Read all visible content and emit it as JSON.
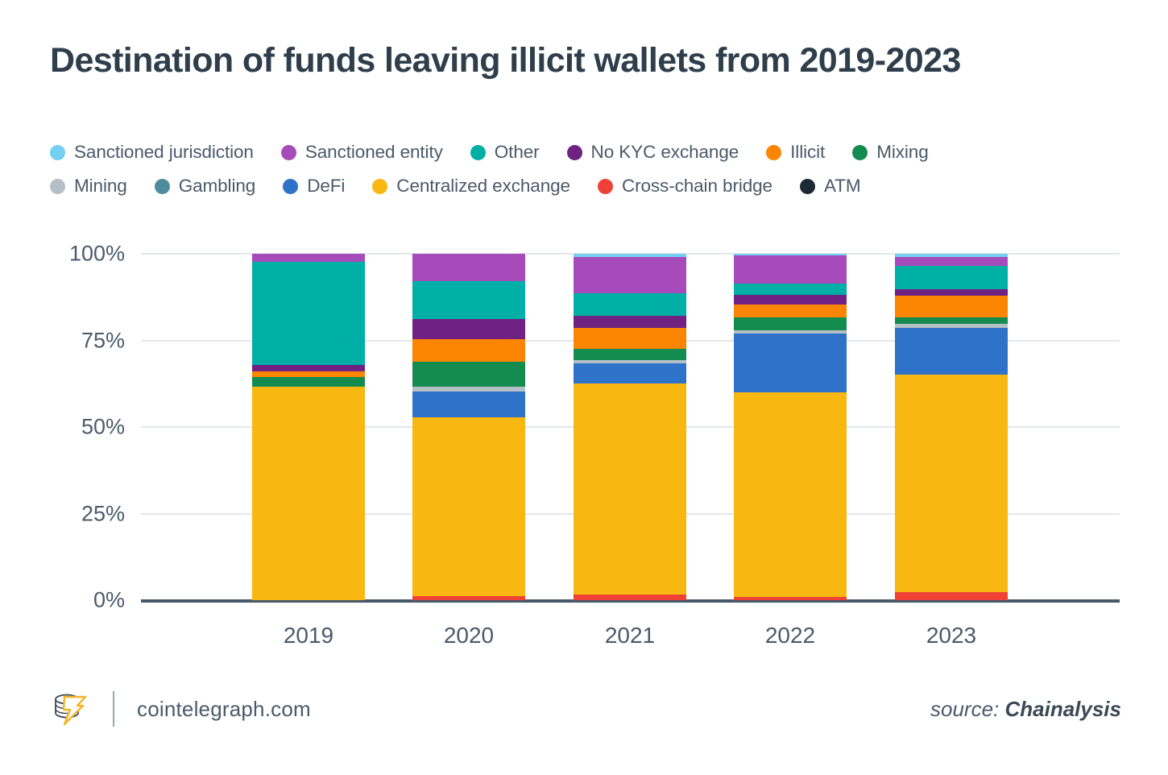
{
  "title": "Destination of funds leaving illicit wallets from 2019-2023",
  "footer": {
    "site": "cointelegraph.com",
    "source_prefix": "source:",
    "source_name": "Chainalysis",
    "logo_name": "cointelegraph-logo"
  },
  "legend": {
    "row1": [
      {
        "label": "Sanctioned jurisdiction",
        "color": "#74cff0"
      },
      {
        "label": "Sanctioned entity",
        "color": "#a74bbb"
      },
      {
        "label": "Other",
        "color": "#00b0a6"
      },
      {
        "label": "No KYC exchange",
        "color": "#702283"
      },
      {
        "label": "Illicit",
        "color": "#fb8500"
      },
      {
        "label": "Mixing",
        "color": "#158c4f"
      }
    ],
    "row2": [
      {
        "label": "Mining",
        "color": "#b4bfc6"
      },
      {
        "label": "Gambling",
        "color": "#4d8c9c"
      },
      {
        "label": "DeFi",
        "color": "#2f72ca"
      },
      {
        "label": "Centralized exchange",
        "color": "#f8b711"
      },
      {
        "label": "Cross-chain bridge",
        "color": "#ef4136"
      },
      {
        "label": "ATM",
        "color": "#1d2a33"
      }
    ]
  },
  "chart_data": {
    "type": "bar",
    "subtype": "stacked-percentage",
    "title": "Destination of funds leaving illicit wallets from 2019-2023",
    "xlabel": "",
    "ylabel": "",
    "ylim": [
      0,
      100
    ],
    "ytick_labels": [
      "0%",
      "25%",
      "50%",
      "75%",
      "100%"
    ],
    "ytick_values": [
      0,
      25,
      50,
      75,
      100
    ],
    "grid": true,
    "legend_position": "top",
    "categories": [
      "2019",
      "2020",
      "2021",
      "2022",
      "2023"
    ],
    "stack_order_bottom_to_top": [
      "ATM",
      "Cross-chain bridge",
      "Centralized exchange",
      "DeFi",
      "Gambling",
      "Mining",
      "Mixing",
      "Illicit",
      "No KYC exchange",
      "Other",
      "Sanctioned entity",
      "Sanctioned jurisdiction"
    ],
    "series": [
      {
        "name": "ATM",
        "color": "#1d2a33",
        "values": [
          0.0,
          0.0,
          0.0,
          0.0,
          0.0
        ]
      },
      {
        "name": "Cross-chain bridge",
        "color": "#ef4136",
        "values": [
          0.0,
          1.2,
          1.6,
          0.9,
          2.4
        ]
      },
      {
        "name": "Centralized exchange",
        "color": "#f8b711",
        "values": [
          61.6,
          51.6,
          61.4,
          59.1,
          62.8
        ]
      },
      {
        "name": "DeFi",
        "color": "#2f72ca",
        "values": [
          0.0,
          7.4,
          6.0,
          17.0,
          13.5
        ]
      },
      {
        "name": "Gambling",
        "color": "#4d8c9c",
        "values": [
          0.0,
          0.0,
          0.0,
          0.0,
          0.0
        ]
      },
      {
        "name": "Mining",
        "color": "#b4bfc6",
        "values": [
          0.0,
          1.4,
          0.9,
          0.9,
          1.2
        ]
      },
      {
        "name": "Mixing",
        "color": "#158c4f",
        "values": [
          2.8,
          7.2,
          3.3,
          3.7,
          1.9
        ]
      },
      {
        "name": "Illicit",
        "color": "#fb8500",
        "values": [
          1.6,
          6.5,
          6.0,
          3.7,
          6.3
        ]
      },
      {
        "name": "No KYC exchange",
        "color": "#702283",
        "values": [
          1.9,
          5.8,
          3.5,
          2.8,
          1.9
        ]
      },
      {
        "name": "Other",
        "color": "#00b0a6",
        "values": [
          29.8,
          11.0,
          6.5,
          3.3,
          6.7
        ]
      },
      {
        "name": "Sanctioned entity",
        "color": "#a74bbb",
        "values": [
          2.3,
          7.9,
          10.7,
          8.1,
          2.6
        ]
      },
      {
        "name": "Sanctioned jurisdiction",
        "color": "#74cff0",
        "values": [
          0.0,
          0.0,
          0.9,
          0.5,
          0.9
        ]
      }
    ]
  }
}
